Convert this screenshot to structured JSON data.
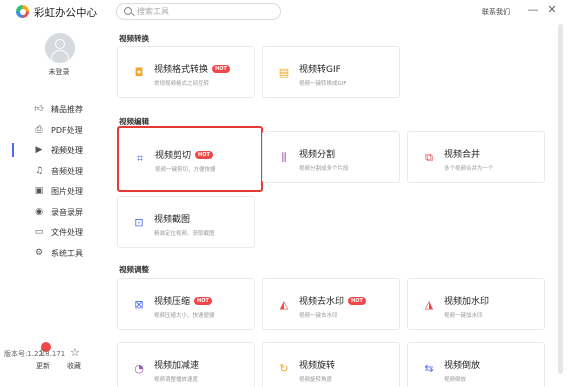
{
  "app": {
    "title": "彩虹办公中心",
    "contact": "联系我们",
    "minimize": "—",
    "close": "✕"
  },
  "search": {
    "placeholder": "搜索工具"
  },
  "user": {
    "login_label": "未登录"
  },
  "sidebar": {
    "items": [
      {
        "label": "精品推荐",
        "icon": "thumb-up-icon",
        "active": false
      },
      {
        "label": "PDF处理",
        "icon": "pdf-icon",
        "active": false
      },
      {
        "label": "视频处理",
        "icon": "video-icon",
        "active": true
      },
      {
        "label": "音频处理",
        "icon": "music-icon",
        "active": false
      },
      {
        "label": "图片处理",
        "icon": "image-icon",
        "active": false
      },
      {
        "label": "录音录屏",
        "icon": "record-icon",
        "active": false
      },
      {
        "label": "文件处理",
        "icon": "folder-icon",
        "active": false
      },
      {
        "label": "系统工具",
        "icon": "system-icon",
        "active": false
      }
    ],
    "update_label": "更新",
    "favorite_label": "收藏",
    "version": "版本号:1.22.8.171"
  },
  "sections": [
    {
      "title": "视频转换",
      "cards": [
        {
          "title": "视频格式转换",
          "desc": "常规视频格式之间互转",
          "hot": true,
          "icon": "video-convert-icon",
          "color": "#f5a623"
        },
        {
          "title": "视频转GIF",
          "desc": "视频一键转换成GIF",
          "hot": false,
          "icon": "gif-icon",
          "color": "#f5a623"
        }
      ]
    },
    {
      "title": "视频编辑",
      "cards": [
        {
          "title": "视频剪切",
          "desc": "视频一键剪切、方便快捷",
          "hot": true,
          "icon": "video-cut-icon",
          "color": "#4a6cf7"
        },
        {
          "title": "视频分割",
          "desc": "视频分割成多个片段",
          "hot": false,
          "icon": "video-split-icon",
          "color": "#9b59b6"
        },
        {
          "title": "视频合并",
          "desc": "多个视频合并为一个",
          "hot": false,
          "icon": "video-merge-icon",
          "color": "#f04848"
        },
        {
          "title": "视频截图",
          "desc": "精准定位视频、获取截图",
          "hot": false,
          "icon": "video-screenshot-icon",
          "color": "#4a6cf7"
        }
      ]
    },
    {
      "title": "视频调整",
      "cards": [
        {
          "title": "视频压缩",
          "desc": "视频压缩大小、快速便捷",
          "hot": true,
          "icon": "video-compress-icon",
          "color": "#4a6cf7"
        },
        {
          "title": "视频去水印",
          "desc": "视频一键去水印",
          "hot": true,
          "icon": "watermark-remove-icon",
          "color": "#f04848"
        },
        {
          "title": "视频加水印",
          "desc": "视频一键加水印",
          "hot": false,
          "icon": "watermark-add-icon",
          "color": "#f04848"
        },
        {
          "title": "视频加减速",
          "desc": "视频调整播放速度",
          "hot": false,
          "icon": "video-speed-icon",
          "color": "#9b59b6"
        },
        {
          "title": "视频旋转",
          "desc": "视频旋转角度",
          "hot": false,
          "icon": "video-rotate-icon",
          "color": "#f5a623"
        },
        {
          "title": "视频倒放",
          "desc": "视频倒放",
          "hot": false,
          "icon": "video-reverse-icon",
          "color": "#4a6cf7"
        }
      ]
    }
  ],
  "badges": {
    "hot": "HOT"
  }
}
